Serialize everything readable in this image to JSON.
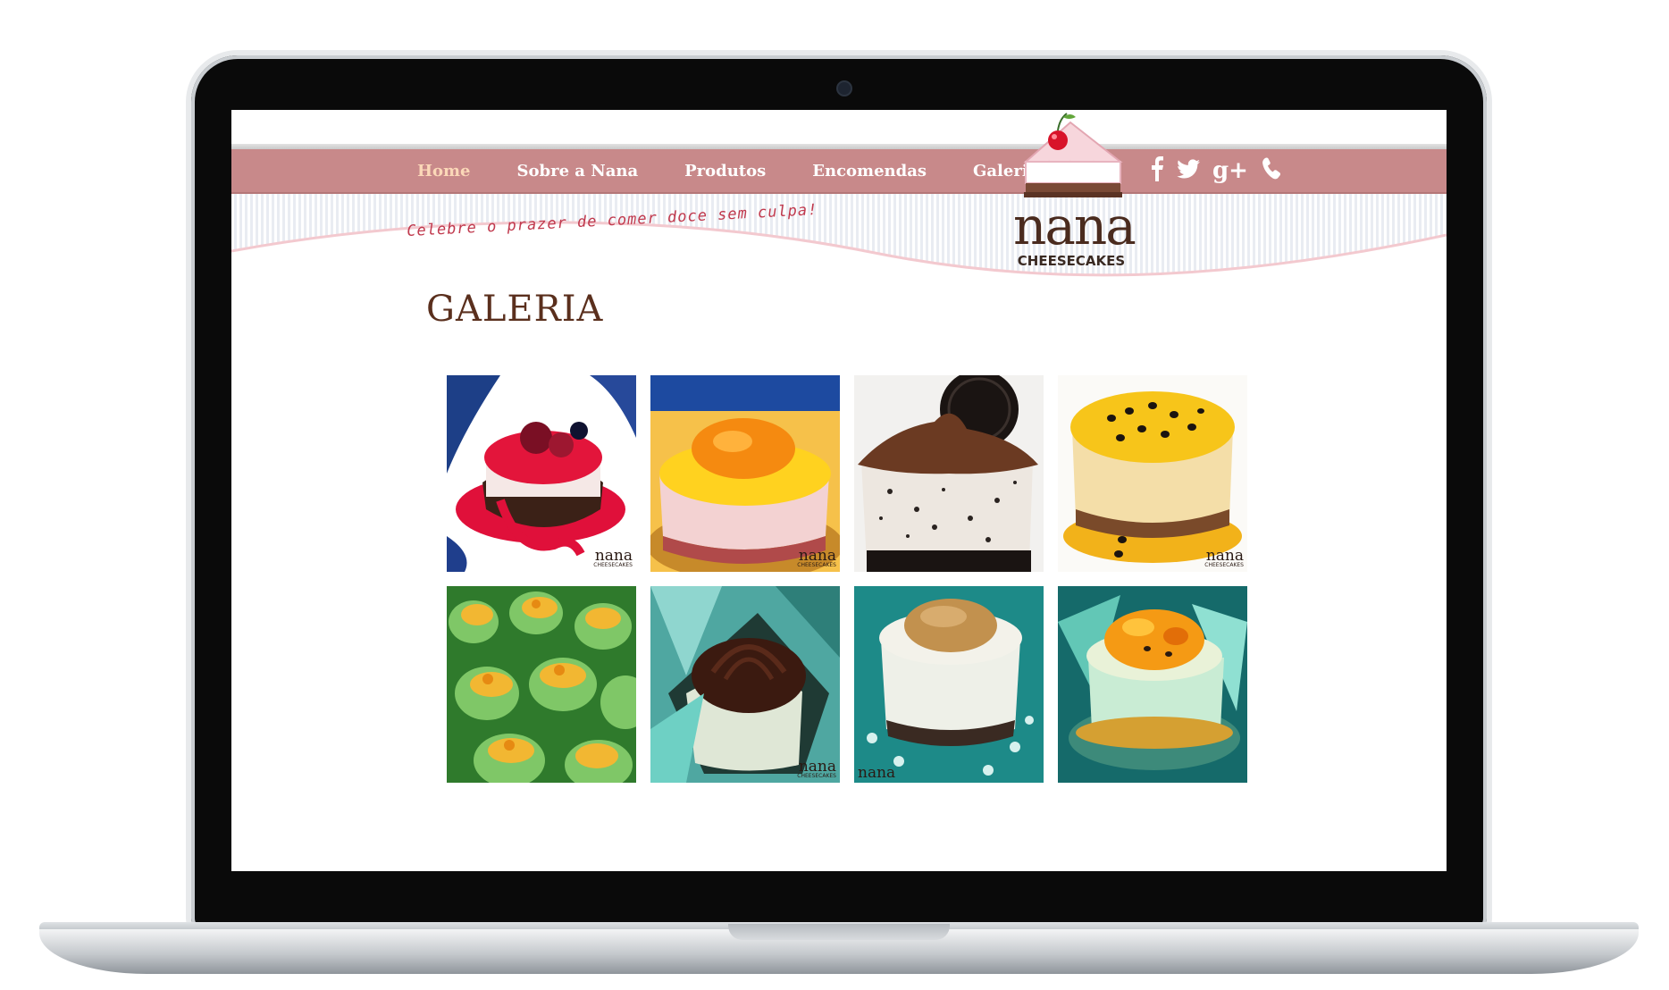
{
  "nav": {
    "items": [
      {
        "label": "Home",
        "active": true
      },
      {
        "label": "Sobre a Nana",
        "active": false
      },
      {
        "label": "Produtos",
        "active": false
      },
      {
        "label": "Encomendas",
        "active": false
      },
      {
        "label": "Galeria",
        "active": false
      }
    ]
  },
  "social": {
    "icons": [
      "facebook-icon",
      "twitter-icon",
      "google-plus-icon",
      "phone-icon"
    ],
    "google_plus_label": "g+"
  },
  "header": {
    "tagline": "Celebre o prazer de comer doce sem culpa!",
    "logo_name": "nana",
    "logo_sub": "CHEESECAKES"
  },
  "main": {
    "title": "GALERIA"
  },
  "gallery": {
    "watermark_name": "nana",
    "watermark_sub": "CHEESECAKES",
    "photos": [
      {
        "subject": "berry-cheesecake",
        "watermark": true
      },
      {
        "subject": "orange-cheesecake",
        "watermark": true
      },
      {
        "subject": "oreo-chocolate-cheesecake",
        "watermark": true
      },
      {
        "subject": "passion-fruit-cheesecake",
        "watermark": true
      },
      {
        "subject": "mini-cheesecakes-green-cups",
        "watermark": false
      },
      {
        "subject": "chocolate-cheesecake-teal-wrap",
        "watermark": true
      },
      {
        "subject": "doce-de-leite-cheesecake",
        "watermark": true
      },
      {
        "subject": "orange-passion-cheesecake",
        "watermark": false
      }
    ]
  },
  "colors": {
    "nav_bar": "#c8898a",
    "nav_active": "#fbd8b8",
    "title": "#5a2f1d",
    "tagline": "#c0394d"
  }
}
